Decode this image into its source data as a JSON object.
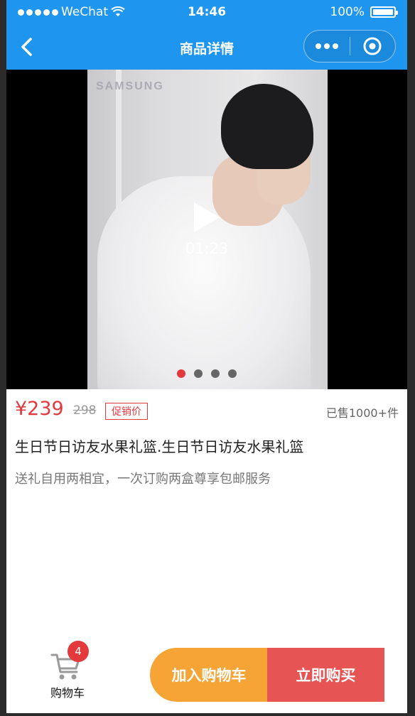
{
  "status_bar": {
    "carrier": "WeChat",
    "time": "14:46",
    "battery": "100%"
  },
  "nav": {
    "title": "商品详情"
  },
  "video": {
    "watermark": "SAMSUNG",
    "duration": "01:23",
    "slide_count": 4,
    "active_slide": 0
  },
  "product": {
    "price": "¥239",
    "original_price": "298",
    "promo_tag": "促销价",
    "sold": "已售1000+件",
    "title": "生日节日访友水果礼篮.生日节日访友水果礼篮",
    "subtitle": "送礼自用两相宜，一次订购两盒尊享包邮服务"
  },
  "bottom_bar": {
    "cart_label": "购物车",
    "cart_count": "4",
    "add_to_cart": "加入购物车",
    "buy_now": "立即购买"
  },
  "colors": {
    "primary": "#1e96f0",
    "price": "#e4393c",
    "add_button": "#f6a435",
    "buy_button": "#e65454"
  }
}
